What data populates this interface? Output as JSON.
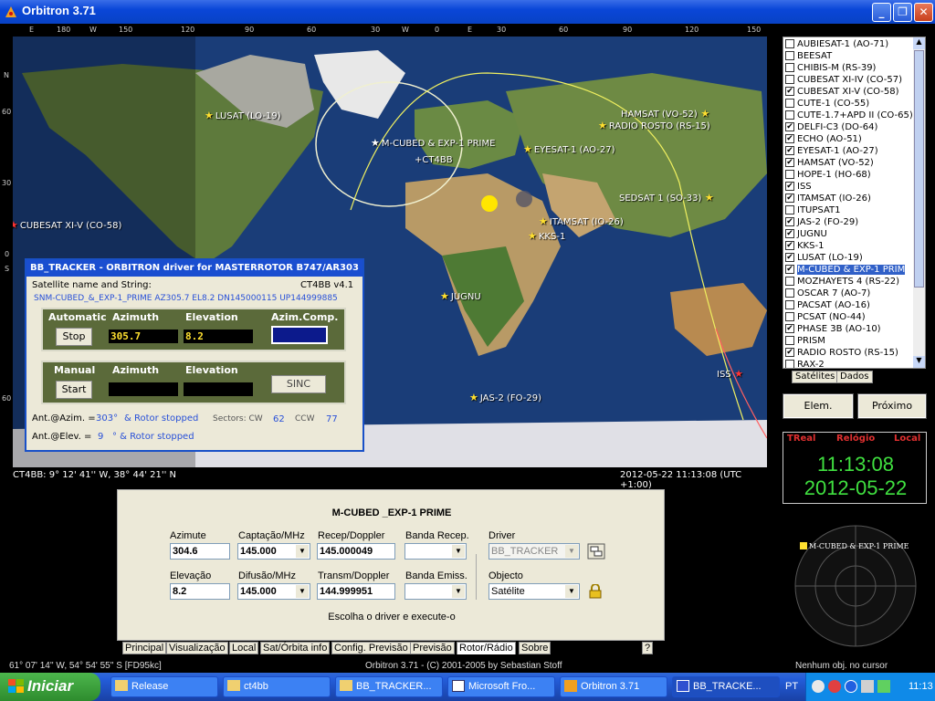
{
  "window": {
    "title": "Orbitron 3.71",
    "min": "_",
    "max": "❐",
    "close": "✕"
  },
  "lon_ruler": [
    "E",
    "180",
    "W",
    "150",
    "120",
    "90",
    "60",
    "30",
    "W",
    "0",
    "E",
    "30",
    "60",
    "90",
    "120",
    "150"
  ],
  "lat_labels": [
    "N",
    "60",
    "30",
    "0",
    "S",
    "60"
  ],
  "map": {
    "satellites": [
      {
        "name": "LUSAT (LO-19)",
        "kind": "yellow"
      },
      {
        "name": "M-CUBED & EXP-1 PRIME",
        "kind": "white"
      },
      {
        "name": "+CT4BB",
        "kind": "plain"
      },
      {
        "name": "EYESAT-1 (AO-27)",
        "kind": "yellow"
      },
      {
        "name": "HAMSAT (VO-52)",
        "kind": "yellow"
      },
      {
        "name": "RADIO ROSTO (RS-15)",
        "kind": "yellow"
      },
      {
        "name": "SEDSAT 1 (SO-33)",
        "kind": "yellow"
      },
      {
        "name": "CUBESAT XI-V (CO-58)",
        "kind": "red"
      },
      {
        "name": "ITAMSAT (IO-26)",
        "kind": "yellow"
      },
      {
        "name": "KKS-1",
        "kind": "yellow"
      },
      {
        "name": "JUGNU",
        "kind": "yellow"
      },
      {
        "name": "ISS",
        "kind": "red"
      },
      {
        "name": "JAS-2 (FO-29)",
        "kind": "yellow"
      }
    ],
    "observer_coords": "CT4BB: 9° 12' 41'' W, 38° 44' 21'' N",
    "datetime": "2012-05-22 11:13:08 (UTC +1:00)"
  },
  "driver": {
    "title": "BB_TRACKER - ORBITRON driver for MASTERROTOR B747/AR303",
    "sat_name_label": "Satellite name and String:",
    "version": "CT4BB v4.1",
    "string": "SNM-CUBED_&_EXP-1_PRIME AZ305.7 EL8.2 DN145000115 UP144999885",
    "auto": {
      "label": "Automatic",
      "button": "Stop",
      "az_label": "Azimuth",
      "el_label": "Elevation",
      "comp_label": "Azim.Comp.",
      "az": "305.7",
      "el": "8.2"
    },
    "manual": {
      "label": "Manual",
      "button": "Start",
      "az_label": "Azimuth",
      "el_label": "Elevation",
      "sinc": "SINC"
    },
    "ant_az_label": "Ant.@Azim. =",
    "ant_az": "303°",
    "ant_az_status": "& Rotor stopped",
    "sectors_label": "Sectors: CW",
    "cw": "62",
    "ccw_label": "CCW",
    "ccw": "77",
    "ant_el_label": "Ant.@Elev. =",
    "ant_el": "9",
    "ant_el_status": "° & Rotor stopped"
  },
  "sat_list": [
    {
      "name": "AUBIESAT-1 (AO-71)",
      "checked": false
    },
    {
      "name": "BEESAT",
      "checked": false
    },
    {
      "name": "CHIBIS-M (RS-39)",
      "checked": false
    },
    {
      "name": "CUBESAT XI-IV (CO-57)",
      "checked": false
    },
    {
      "name": "CUBESAT XI-V (CO-58)",
      "checked": true
    },
    {
      "name": "CUTE-1 (CO-55)",
      "checked": false
    },
    {
      "name": "CUTE-1.7+APD II (CO-65)",
      "checked": false
    },
    {
      "name": "DELFI-C3 (DO-64)",
      "checked": true
    },
    {
      "name": "ECHO (AO-51)",
      "checked": true
    },
    {
      "name": "EYESAT-1 (AO-27)",
      "checked": true
    },
    {
      "name": "HAMSAT (VO-52)",
      "checked": true
    },
    {
      "name": "HOPE-1 (HO-68)",
      "checked": false
    },
    {
      "name": "ISS",
      "checked": true
    },
    {
      "name": "ITAMSAT (IO-26)",
      "checked": true
    },
    {
      "name": "ITUPSAT1",
      "checked": false
    },
    {
      "name": "JAS-2 (FO-29)",
      "checked": true
    },
    {
      "name": "JUGNU",
      "checked": true
    },
    {
      "name": "KKS-1",
      "checked": true
    },
    {
      "name": "LUSAT (LO-19)",
      "checked": true
    },
    {
      "name": "M-CUBED & EXP-1 PRIM",
      "checked": true,
      "selected": true
    },
    {
      "name": "MOZHAYETS 4 (RS-22)",
      "checked": false
    },
    {
      "name": "OSCAR 7 (AO-7)",
      "checked": false
    },
    {
      "name": "PACSAT (AO-16)",
      "checked": false
    },
    {
      "name": "PCSAT (NO-44)",
      "checked": false
    },
    {
      "name": "PHASE 3B (AO-10)",
      "checked": true
    },
    {
      "name": "PRISM",
      "checked": false
    },
    {
      "name": "RADIO ROSTO (RS-15)",
      "checked": true
    },
    {
      "name": "RAX-2",
      "checked": false
    }
  ],
  "side_tabs": [
    "Satélites",
    "Dados"
  ],
  "side_buttons": {
    "elements": "Elem. Orbitais",
    "next": "Próximo"
  },
  "clock": {
    "treal": "TReal",
    "relogio": "Relógio",
    "local": "Local",
    "time": "11:13:08",
    "date": "2012-05-22"
  },
  "radar_label": "M-CUBED & EXP-1 PRIME",
  "radio": {
    "title": "M-CUBED _EXP-1 PRIME",
    "azimute_label": "Azimute",
    "azimute": "304.6",
    "captacao_label": "Captação/MHz",
    "captacao": "145.000",
    "recep_label": "Recep/Doppler",
    "recep": "145.000049",
    "banda_recep_label": "Banda Recep.",
    "driver_label": "Driver",
    "driver": "BB_TRACKER",
    "elevacao_label": "Elevação",
    "elevacao": "8.2",
    "difusao_label": "Difusão/MHz",
    "difusao": "145.000",
    "transm_label": "Transm/Doppler",
    "transm": "144.999951",
    "banda_emiss_label": "Banda Emiss.",
    "objecto_label": "Objecto",
    "objecto": "Satélite",
    "hint": "Escolha o driver e execute-o"
  },
  "bottom_tabs": [
    "Principal",
    "Visualização",
    "Local",
    "Sat/Órbita info",
    "Config. Previsão",
    "Previsão",
    "Rotor/Rádio",
    "Sobre"
  ],
  "help": "?",
  "footer": {
    "cursor": "61° 07' 14'' W, 54° 54' 55'' S [FD95kc]",
    "copyright": "Orbitron 3.71 - (C) 2001-2005 by Sebastian Stoff",
    "obj": "Nenhum obj. no cursor"
  },
  "taskbar": {
    "start": "Iniciar",
    "tasks": [
      "Release",
      "ct4bb",
      "BB_TRACKER...",
      "Microsoft Fro...",
      "Orbitron 3.71",
      "BB_TRACKE..."
    ],
    "lang": "PT",
    "time": "11:13"
  }
}
